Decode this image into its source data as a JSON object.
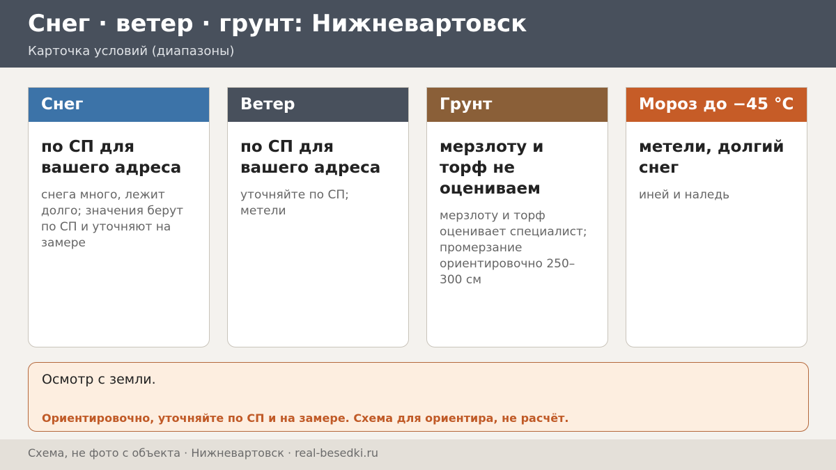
{
  "header": {
    "title": "Снег · ветер · грунт: Нижневартовск",
    "subtitle": "Карточка условий (диапазоны)"
  },
  "cards": [
    {
      "title": "Снег",
      "main": "по СП для вашего адреса",
      "note": "снега много, лежит долго; значения берут по СП и уточняют на замере",
      "color": "#3c73a8"
    },
    {
      "title": "Ветер",
      "main": "по СП для вашего адреса",
      "note": "уточняйте по СП; метели",
      "color": "#48505c"
    },
    {
      "title": "Грунт",
      "main": "мерзлоту и торф не оцениваем",
      "note": "мерзлоту и торф оценивает специалист; промерзание ориентировочно 250–300 см",
      "color": "#8a5f38"
    },
    {
      "title": "Мороз до −45 °C",
      "main": "метели, долгий снег",
      "note": "иней и наледь",
      "color": "#c65c27"
    }
  ],
  "inspection": {
    "text": "Осмотр с земли.",
    "warning": "Ориентировочно, уточняйте по СП и на замере. Схема для ориентира, не расчёт."
  },
  "footer": {
    "text": "Схема, не фото с объекта  ·  Нижневартовск  ·  real-besedki.ru"
  }
}
